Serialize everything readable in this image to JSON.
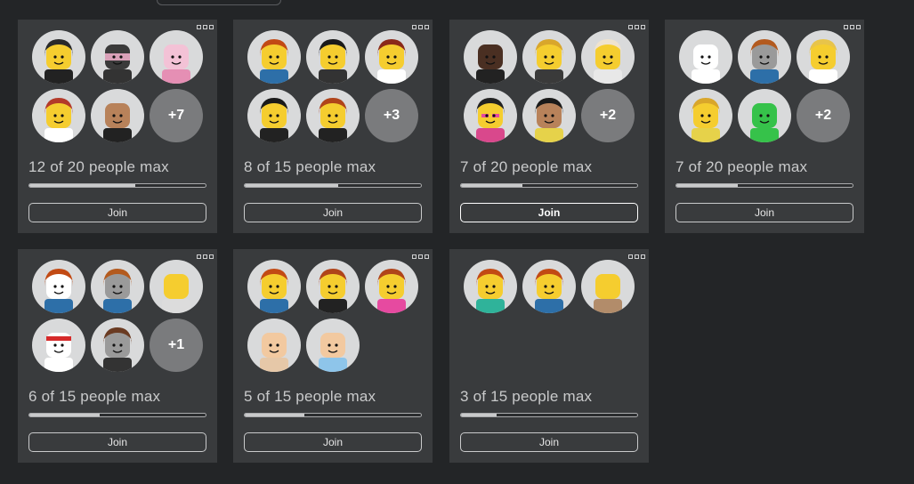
{
  "servers": [
    {
      "count_label": "12 of 20 people max",
      "fill": 0.6,
      "join_label": "Join",
      "more": "+7",
      "active": false,
      "avatars": [
        {
          "face": "dark-hair",
          "shirt": "#222222"
        },
        {
          "face": "mask",
          "shirt": "#333333"
        },
        {
          "face": "pink",
          "shirt": "#e58fb4"
        },
        {
          "face": "redcap",
          "shirt": "#ffffff"
        },
        {
          "face": "dark-man",
          "shirt": "#222222"
        }
      ]
    },
    {
      "count_label": "8 of 15 people max",
      "fill": 0.53,
      "join_label": "Join",
      "more": "+3",
      "active": false,
      "avatars": [
        {
          "face": "red-hair",
          "shirt": "#2d6fa8"
        },
        {
          "face": "black-long",
          "shirt": "#333333"
        },
        {
          "face": "red-small",
          "shirt": "#ffffff"
        },
        {
          "face": "black-long",
          "shirt": "#222222"
        },
        {
          "face": "red-hair-dark",
          "shirt": "#222222"
        }
      ]
    },
    {
      "count_label": "7 of 20 people max",
      "fill": 0.35,
      "join_label": "Join",
      "more": "+2",
      "active": true,
      "avatars": [
        {
          "face": "dark-run",
          "shirt": "#222222"
        },
        {
          "face": "blonde-boy",
          "shirt": "#3a3a3a"
        },
        {
          "face": "platinum",
          "shirt": "#e8e8e8"
        },
        {
          "face": "pink-glasses",
          "shirt": "#d9488c"
        },
        {
          "face": "black-girl",
          "shirt": "#e6d24a"
        }
      ]
    },
    {
      "count_label": "7 of 20 people max",
      "fill": 0.35,
      "join_label": "Join",
      "more": "+2",
      "active": false,
      "avatars": [
        {
          "face": "white-crown",
          "shirt": "#ffffff"
        },
        {
          "face": "gray-redhair",
          "shirt": "#2d6fa8"
        },
        {
          "face": "blonde-long",
          "shirt": "#ffffff"
        },
        {
          "face": "blonde-boy",
          "shirt": "#e6d24a"
        },
        {
          "face": "green",
          "shirt": "#36c24a"
        }
      ]
    },
    {
      "count_label": "6 of 15 people max",
      "fill": 0.4,
      "join_label": "Join",
      "more": "+1",
      "active": false,
      "avatars": [
        {
          "face": "red-hair-white",
          "shirt": "#2d6fa8"
        },
        {
          "face": "gray-redhair",
          "shirt": "#2d6fa8"
        },
        {
          "face": "tiny-girl",
          "shirt": "#dcdcdc"
        },
        {
          "face": "red-band",
          "shirt": "#ffffff"
        },
        {
          "face": "brown-gray",
          "shirt": "#333333"
        }
      ]
    },
    {
      "count_label": "5 of 15 people max",
      "fill": 0.34,
      "join_label": "Join",
      "more": "",
      "active": false,
      "avatars": [
        {
          "face": "red-hair",
          "shirt": "#2d6fa8"
        },
        {
          "face": "red-hair-dark",
          "shirt": "#222222"
        },
        {
          "face": "red-hair-pink",
          "shirt": "#e64aa0"
        },
        {
          "face": "bald",
          "shirt": "#e6c8a8"
        },
        {
          "face": "bald",
          "shirt": "#8ec5ea"
        }
      ]
    },
    {
      "count_label": "3 of 15 people max",
      "fill": 0.2,
      "join_label": "Join",
      "more": "",
      "active": false,
      "avatars": [
        {
          "face": "red-hair",
          "shirt": "#2fb39a"
        },
        {
          "face": "red-hair",
          "shirt": "#2d6fa8"
        },
        {
          "face": "brown-tiny",
          "shirt": "#b28c6a"
        }
      ]
    }
  ]
}
